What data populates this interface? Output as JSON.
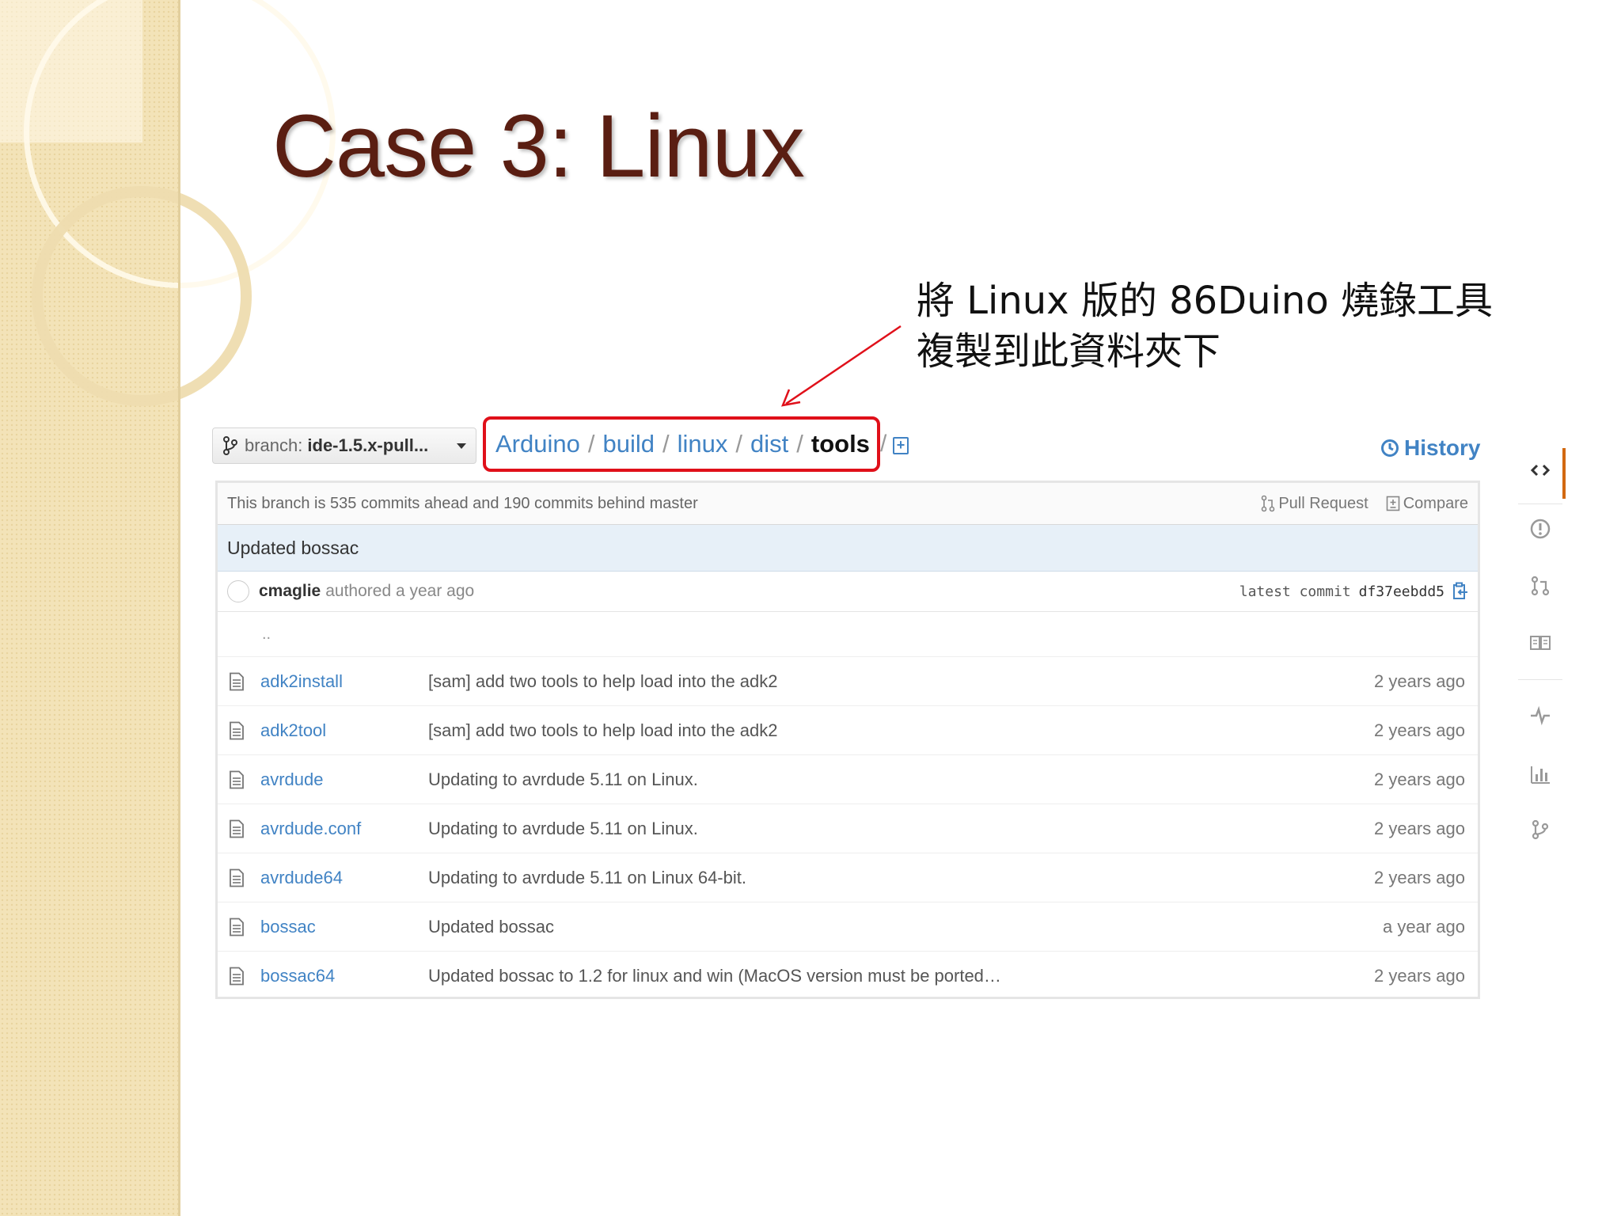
{
  "slide": {
    "title": "Case 3: Linux",
    "annotation_line1": "將 Linux 版的 86Duino 燒錄工具",
    "annotation_line2": "複製到此資料夾下"
  },
  "branch": {
    "label": "branch:",
    "value": "ide-1.5.x-pull..."
  },
  "breadcrumb": {
    "segments": [
      "Arduino",
      "build",
      "linux",
      "dist"
    ],
    "current": "tools",
    "separator": "/",
    "highlight_color": "#e0101a"
  },
  "history_label": "History",
  "tracker": {
    "text": "This branch is 535 commits ahead and 190 commits behind master",
    "pull_request_label": "Pull Request",
    "compare_label": "Compare"
  },
  "commit": {
    "title": "Updated bossac",
    "author": "cmaglie",
    "authored": "authored a year ago",
    "latest_label": "latest commit",
    "sha": "df37eebdd5"
  },
  "updir": "..",
  "files": [
    {
      "name": "adk2install",
      "message": "[sam] add two tools to help load into the adk2",
      "age": "2 years ago"
    },
    {
      "name": "adk2tool",
      "message": "[sam] add two tools to help load into the adk2",
      "age": "2 years ago"
    },
    {
      "name": "avrdude",
      "message": "Updating to avrdude 5.11 on Linux.",
      "age": "2 years ago"
    },
    {
      "name": "avrdude.conf",
      "message": "Updating to avrdude 5.11 on Linux.",
      "age": "2 years ago"
    },
    {
      "name": "avrdude64",
      "message": "Updating to avrdude 5.11 on Linux 64-bit.",
      "age": "2 years ago"
    },
    {
      "name": "bossac",
      "message": "Updated bossac",
      "age": "a year ago"
    },
    {
      "name": "bossac64",
      "message": "Updated bossac to 1.2 for linux and win (MacOS version must be ported…",
      "age": "2 years ago"
    }
  ],
  "right_nav_icons": [
    "code-icon",
    "issues-icon",
    "pull-request-icon",
    "wiki-icon",
    "pulse-icon",
    "graphs-icon",
    "network-icon"
  ],
  "colors": {
    "link": "#4183c4",
    "title": "#5a1e12",
    "accent_nav": "#d26911"
  }
}
